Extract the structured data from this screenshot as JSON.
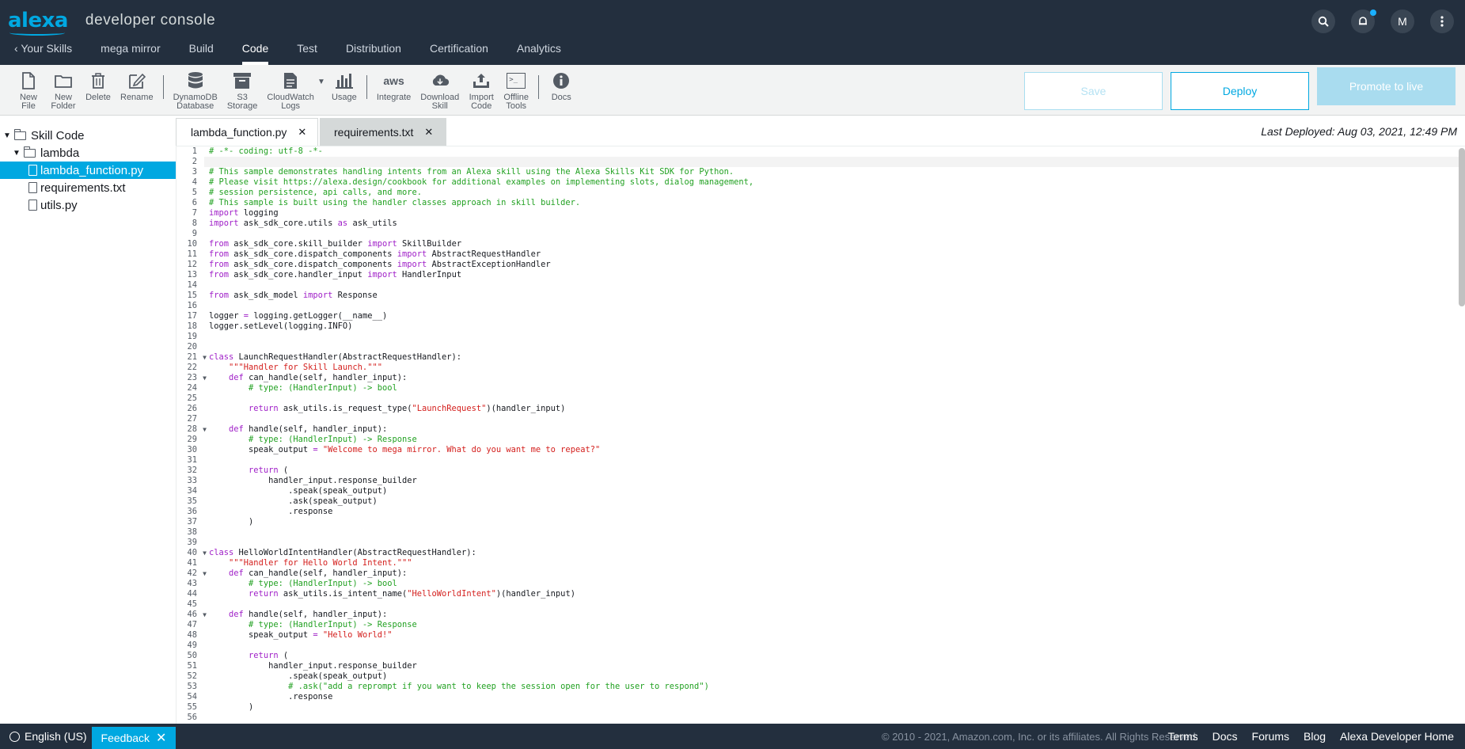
{
  "header": {
    "brand_logo": "alexa",
    "brand_title": "developer console",
    "avatar_initial": "M"
  },
  "nav": {
    "back_label": "Your Skills",
    "items": [
      "mega mirror",
      "Build",
      "Code",
      "Test",
      "Distribution",
      "Certification",
      "Analytics"
    ],
    "active": "Code"
  },
  "toolbar": {
    "new_file": "New\nFile",
    "new_folder": "New\nFolder",
    "delete": "Delete",
    "rename": "Rename",
    "dynamodb": "DynamoDB\nDatabase",
    "s3": "S3\nStorage",
    "cloudwatch": "CloudWatch\nLogs",
    "usage": "Usage",
    "integrate": "Integrate",
    "integrate_icon_text": "aws",
    "download": "Download\nSkill",
    "import": "Import\nCode",
    "offline": "Offline\nTools",
    "offline_icon_text": ">_",
    "docs": "Docs",
    "save_label": "Save",
    "deploy_label": "Deploy",
    "promote_label": "Promote to live"
  },
  "tree": {
    "root": "Skill Code",
    "folder": "lambda",
    "files": [
      "lambda_function.py",
      "requirements.txt",
      "utils.py"
    ],
    "selected": "lambda_function.py"
  },
  "tabs": [
    {
      "label": "lambda_function.py",
      "active": true
    },
    {
      "label": "requirements.txt",
      "active": false
    }
  ],
  "last_deployed": "Last Deployed: Aug 03, 2021, 12:49 PM",
  "code": {
    "cursor_line": 2,
    "lines": [
      "# -*- coding: utf-8 -*-",
      "",
      "# This sample demonstrates handling intents from an Alexa skill using the Alexa Skills Kit SDK for Python.",
      "# Please visit https://alexa.design/cookbook for additional examples on implementing slots, dialog management,",
      "# session persistence, api calls, and more.",
      "# This sample is built using the handler classes approach in skill builder.",
      "import logging",
      "import ask_sdk_core.utils as ask_utils",
      "",
      "from ask_sdk_core.skill_builder import SkillBuilder",
      "from ask_sdk_core.dispatch_components import AbstractRequestHandler",
      "from ask_sdk_core.dispatch_components import AbstractExceptionHandler",
      "from ask_sdk_core.handler_input import HandlerInput",
      "",
      "from ask_sdk_model import Response",
      "",
      "logger = logging.getLogger(__name__)",
      "logger.setLevel(logging.INFO)",
      "",
      "",
      "class LaunchRequestHandler(AbstractRequestHandler):",
      "    \"\"\"Handler for Skill Launch.\"\"\"",
      "    def can_handle(self, handler_input):",
      "        # type: (HandlerInput) -> bool",
      "",
      "        return ask_utils.is_request_type(\"LaunchRequest\")(handler_input)",
      "",
      "    def handle(self, handler_input):",
      "        # type: (HandlerInput) -> Response",
      "        speak_output = \"Welcome to mega mirror. What do you want me to repeat?\"",
      "",
      "        return (",
      "            handler_input.response_builder",
      "                .speak(speak_output)",
      "                .ask(speak_output)",
      "                .response",
      "        )",
      "",
      "",
      "class HelloWorldIntentHandler(AbstractRequestHandler):",
      "    \"\"\"Handler for Hello World Intent.\"\"\"",
      "    def can_handle(self, handler_input):",
      "        # type: (HandlerInput) -> bool",
      "        return ask_utils.is_intent_name(\"HelloWorldIntent\")(handler_input)",
      "",
      "    def handle(self, handler_input):",
      "        # type: (HandlerInput) -> Response",
      "        speak_output = \"Hello World!\"",
      "",
      "        return (",
      "            handler_input.response_builder",
      "                .speak(speak_output)",
      "                # .ask(\"add a reprompt if you want to keep the session open for the user to respond\")",
      "                .response",
      "        )",
      ""
    ],
    "fold_lines": [
      21,
      23,
      28,
      40,
      42,
      46
    ]
  },
  "footer": {
    "language": "English (US)",
    "feedback_label": "Feedback",
    "copyright": "© 2010 - 2021, Amazon.com, Inc. or its affiliates. All Rights Reserved.",
    "links": [
      "Terms",
      "Docs",
      "Forums",
      "Blog",
      "Alexa Developer Home"
    ]
  },
  "colors": {
    "header_bg": "#232f3e",
    "accent": "#00a8e1",
    "comment": "#22a122",
    "keyword": "#a020c8",
    "string": "#d4201e"
  }
}
